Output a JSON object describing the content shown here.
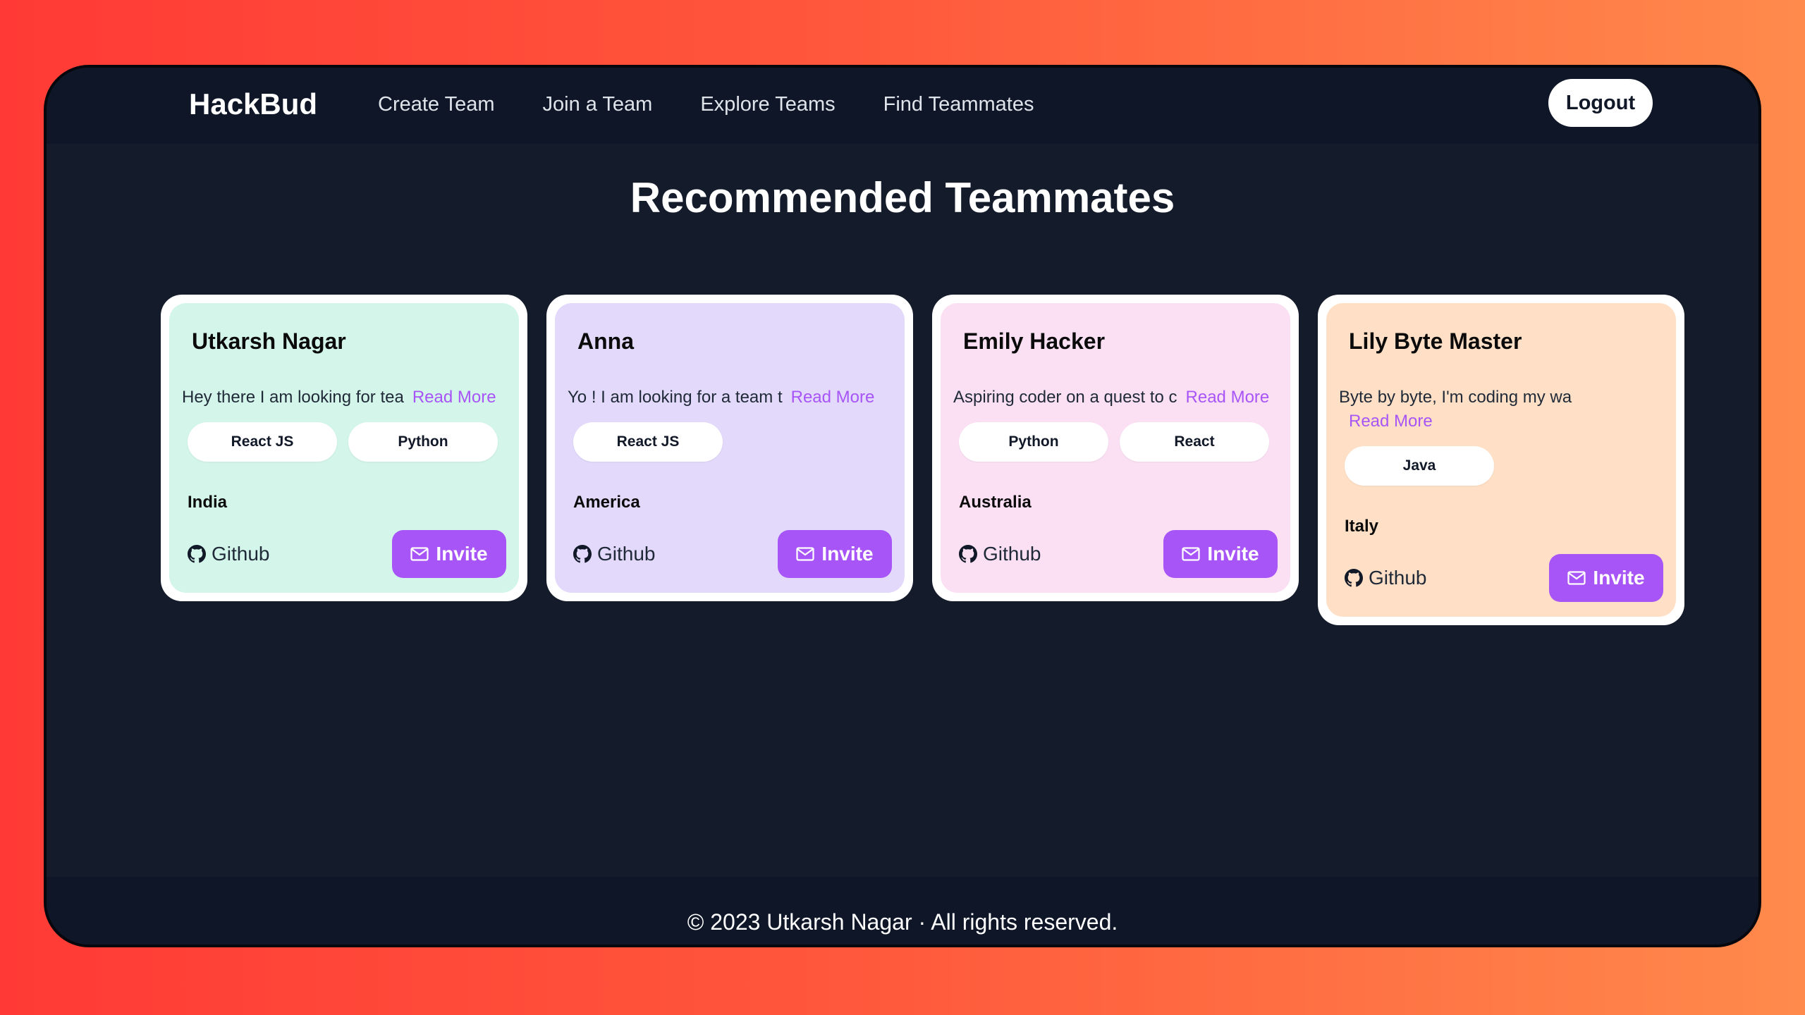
{
  "brand": "HackBud",
  "nav": {
    "links": [
      "Create Team",
      "Join a Team",
      "Explore Teams",
      "Find Teammates"
    ],
    "logout_label": "Logout"
  },
  "page_title": "Recommended Teammates",
  "colors": {
    "accent": "#a855f7",
    "card1_bg": "#d4f5ea",
    "card2_bg": "#e2d9fb",
    "card3_bg": "#fbe0f4",
    "card4_bg": "#ffe0c6"
  },
  "cards": [
    {
      "name": "Utkarsh Nagar",
      "bio": "Hey there I am looking for tea",
      "read_more": "Read More",
      "skills": [
        "React JS",
        "Python"
      ],
      "country": "India",
      "github_label": "Github",
      "invite_label": "Invite"
    },
    {
      "name": "Anna",
      "bio": "Yo ! I am looking for a team t",
      "read_more": "Read More",
      "skills": [
        "React JS"
      ],
      "country": "America",
      "github_label": "Github",
      "invite_label": "Invite"
    },
    {
      "name": "Emily Hacker",
      "bio": "Aspiring coder on a quest to c",
      "read_more": "Read More",
      "skills": [
        "Python",
        "React"
      ],
      "country": "Australia",
      "github_label": "Github",
      "invite_label": "Invite"
    },
    {
      "name": "Lily Byte Master",
      "bio": "Byte by byte, I'm coding my wa",
      "read_more": "Read More",
      "skills": [
        "Java"
      ],
      "country": "Italy",
      "github_label": "Github",
      "invite_label": "Invite"
    }
  ],
  "footer": "© 2023 Utkarsh Nagar · All rights reserved."
}
